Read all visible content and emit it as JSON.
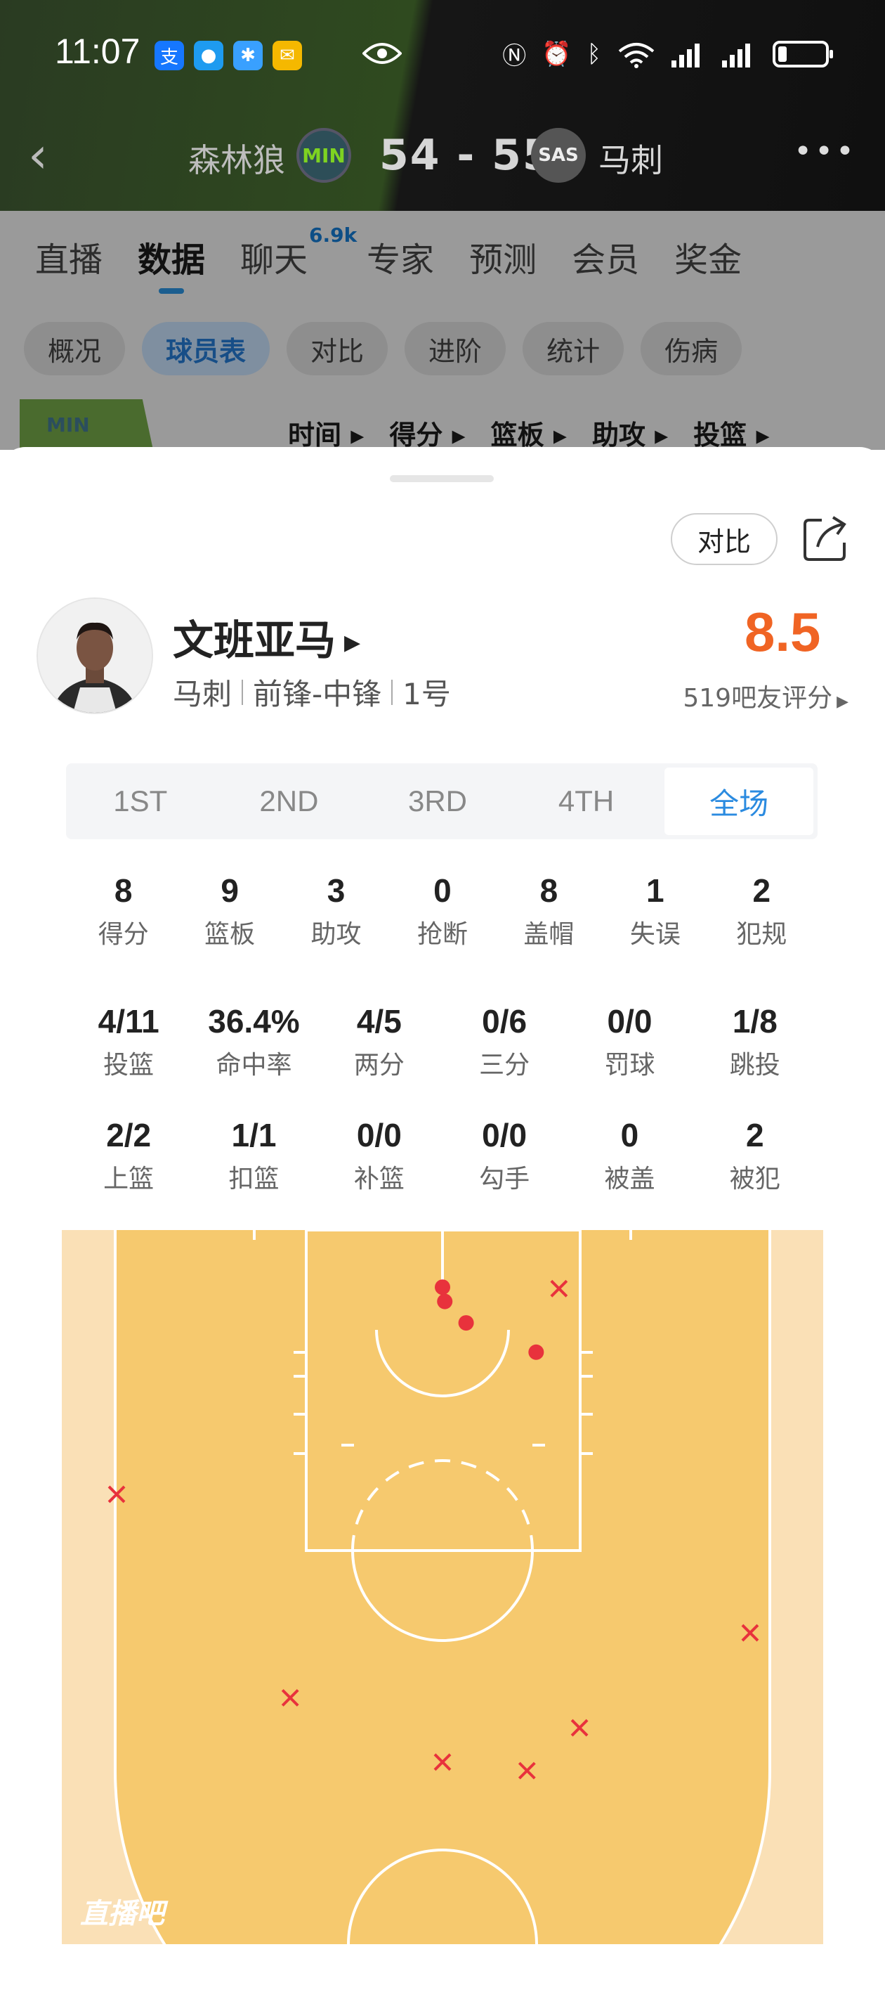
{
  "status_bar": {
    "time": "11:07",
    "app_icons": [
      {
        "name": "alipay-icon",
        "glyph": "支",
        "color": "#1677ff"
      },
      {
        "name": "message-icon",
        "glyph": "●",
        "color": "#1e9bf0"
      },
      {
        "name": "calendar-icon",
        "glyph": "✱",
        "color": "#39a0ff"
      },
      {
        "name": "mail-icon",
        "glyph": "✉",
        "color": "#f5b800"
      }
    ],
    "right_icons": [
      "N",
      "⏰",
      "✱",
      "WiFi",
      "▮▮",
      "▮▮"
    ]
  },
  "header": {
    "home_team": "森林狼",
    "home_logo": "MIN",
    "score": "54 - 55",
    "away_logo": "SAS",
    "away_team": "马刺"
  },
  "main_tabs": [
    {
      "label": "直播"
    },
    {
      "label": "数据",
      "active": true
    },
    {
      "label": "聊天",
      "badge": "6.9k"
    },
    {
      "label": "专家"
    },
    {
      "label": "预测"
    },
    {
      "label": "会员"
    },
    {
      "label": "奖金"
    }
  ],
  "sub_tabs": [
    {
      "label": "概况"
    },
    {
      "label": "球员表",
      "active": true
    },
    {
      "label": "对比"
    },
    {
      "label": "进阶"
    },
    {
      "label": "统计"
    },
    {
      "label": "伤病"
    }
  ],
  "table_columns": {
    "team_logo": "MIN",
    "columns": [
      "时间 ▸",
      "得分 ▸",
      "篮板 ▸",
      "助攻 ▸",
      "投篮 ▸"
    ]
  },
  "sheet": {
    "compare_label": "对比",
    "player": {
      "name": "文班亚马",
      "team": "马刺",
      "position": "前锋-中锋",
      "number": "1号"
    },
    "rating": "8.5",
    "rating_count": "519吧友评分",
    "period_tabs": [
      {
        "label": "1ST"
      },
      {
        "label": "2ND"
      },
      {
        "label": "3RD"
      },
      {
        "label": "4TH"
      },
      {
        "label": "全场",
        "active": true
      }
    ],
    "stats_row1": [
      {
        "value": "8",
        "label": "得分"
      },
      {
        "value": "9",
        "label": "篮板"
      },
      {
        "value": "3",
        "label": "助攻"
      },
      {
        "value": "0",
        "label": "抢断"
      },
      {
        "value": "8",
        "label": "盖帽"
      },
      {
        "value": "1",
        "label": "失误"
      },
      {
        "value": "2",
        "label": "犯规"
      }
    ],
    "stats_row2": [
      {
        "value": "4/11",
        "label": "投篮"
      },
      {
        "value": "36.4%",
        "label": "命中率"
      },
      {
        "value": "4/5",
        "label": "两分"
      },
      {
        "value": "0/6",
        "label": "三分"
      },
      {
        "value": "0/0",
        "label": "罚球"
      },
      {
        "value": "1/8",
        "label": "跳投"
      }
    ],
    "stats_row3": [
      {
        "value": "2/2",
        "label": "上篮"
      },
      {
        "value": "1/1",
        "label": "扣篮"
      },
      {
        "value": "0/0",
        "label": "补篮"
      },
      {
        "value": "0/0",
        "label": "勾手"
      },
      {
        "value": "0",
        "label": "被盖"
      },
      {
        "value": "2",
        "label": "被犯"
      }
    ],
    "shot_chart": {
      "made_color": "#e8323c",
      "missed_color": "#e8323c",
      "court_color": "#f6c96e",
      "outside_color": "#fae0b6",
      "watermark": "直播吧",
      "made": [
        [
          0.5,
          0.08
        ],
        [
          0.503,
          0.1
        ],
        [
          0.531,
          0.13
        ],
        [
          0.623,
          0.171
        ]
      ],
      "missed": [
        [
          0.653,
          0.082
        ],
        [
          0.072,
          0.37
        ],
        [
          0.904,
          0.564
        ],
        [
          0.3,
          0.655
        ],
        [
          0.68,
          0.697
        ],
        [
          0.5,
          0.745
        ],
        [
          0.611,
          0.757
        ]
      ]
    }
  }
}
